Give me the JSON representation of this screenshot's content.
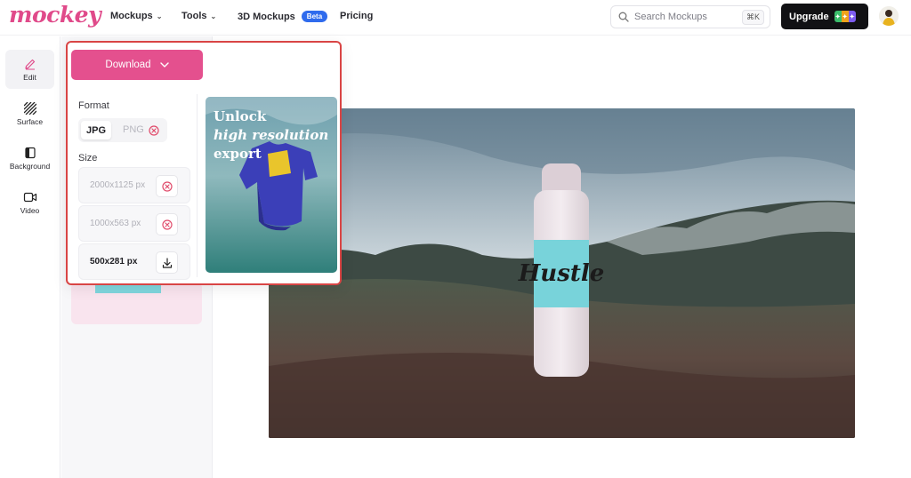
{
  "brand": {
    "logo_text": "mockey"
  },
  "nav": [
    {
      "label": "Mockups",
      "has_chevron": true
    },
    {
      "label": "Tools",
      "has_chevron": true
    },
    {
      "label": "3D Mockups",
      "badge": "Beta"
    },
    {
      "label": "Pricing"
    }
  ],
  "search": {
    "placeholder": "Search Mockups",
    "shortcut": "⌘K"
  },
  "upgrade": {
    "label": "Upgrade"
  },
  "rail": [
    {
      "label": "Edit",
      "icon": "pencil-icon",
      "active": true
    },
    {
      "label": "Surface",
      "icon": "hatch-icon"
    },
    {
      "label": "Background",
      "icon": "background-icon"
    },
    {
      "label": "Video",
      "icon": "video-icon"
    }
  ],
  "download": {
    "button_label": "Download",
    "format_label": "Format",
    "formats": [
      {
        "label": "JPG",
        "selected": true
      },
      {
        "label": "PNG",
        "locked": true
      }
    ],
    "size_label": "Size",
    "sizes": [
      {
        "label": "2000x1125 px",
        "locked": true
      },
      {
        "label": "1000x563 px",
        "locked": true
      },
      {
        "label": "500x281 px",
        "locked": false,
        "action": "download-icon"
      }
    ],
    "promo": {
      "line1": "Unlock",
      "line2": "high resolution",
      "line3": "export"
    }
  },
  "colors": {
    "brand": "#e04a8a",
    "download_button": "#e4508e",
    "highlight_border": "#d94545",
    "beta_badge": "#2f6bed",
    "upgrade_bg": "#111114"
  }
}
